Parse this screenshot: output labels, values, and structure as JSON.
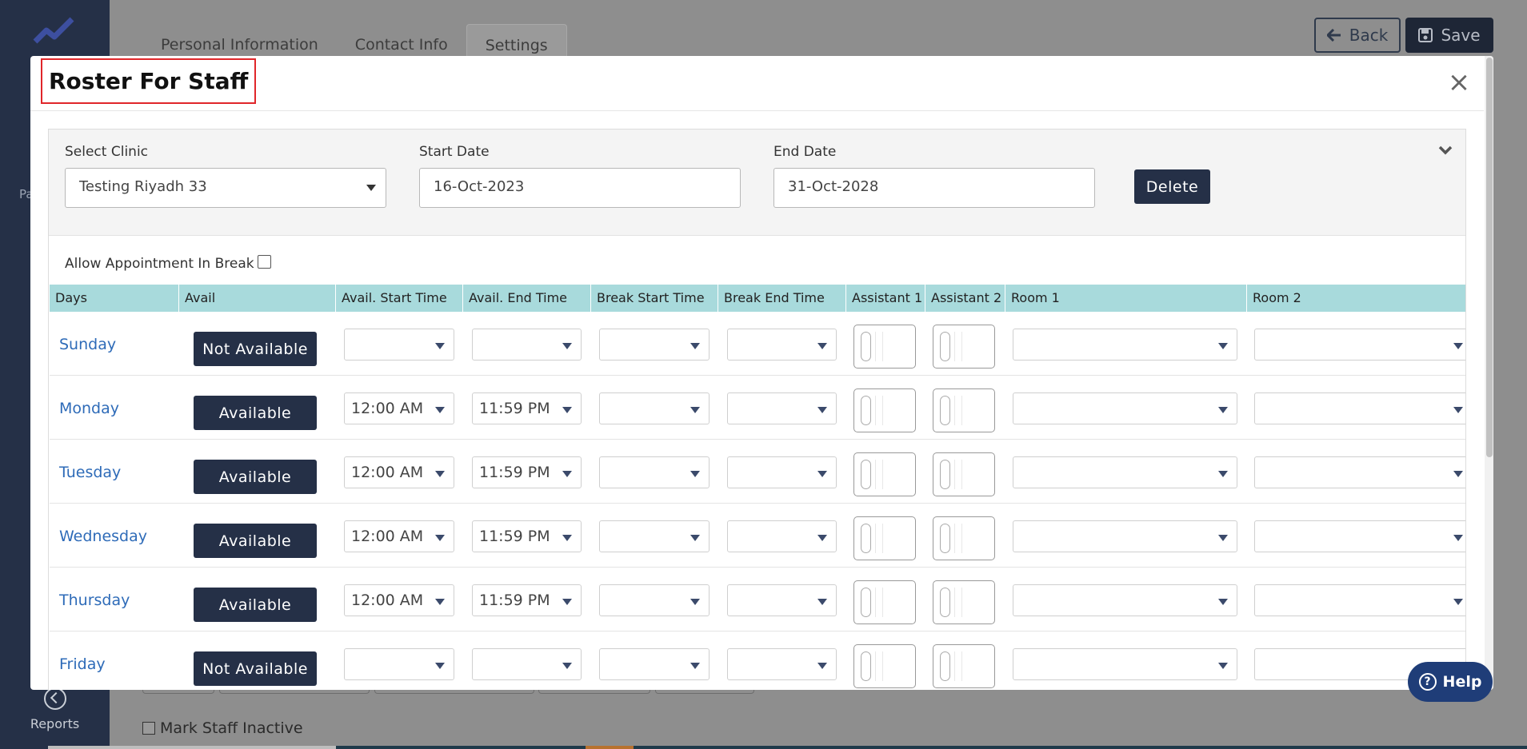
{
  "background": {
    "tabs": [
      {
        "label": "Personal Information"
      },
      {
        "label": "Contact Info"
      },
      {
        "label": "Settings"
      }
    ],
    "back_label": "Back",
    "save_label": "Save",
    "sidebar_partial_text": "Pa",
    "reports_label": "Reports",
    "mark_inactive_label": "Mark Staff Inactive"
  },
  "modal": {
    "title": "Roster For Staff",
    "close_glyph": "×",
    "filters": {
      "clinic_label": "Select Clinic",
      "clinic_value": "Testing Riyadh 33",
      "start_label": "Start Date",
      "start_value": "16-Oct-2023",
      "end_label": "End Date",
      "end_value": "31-Oct-2028",
      "delete_label": "Delete"
    },
    "allow_break_label": "Allow Appointment In Break",
    "table": {
      "headers": [
        "Days",
        "Avail",
        "Avail. Start Time",
        "Avail. End Time",
        "Break Start Time",
        "Break End Time",
        "Assistant 1",
        "Assistant 2",
        "Room 1",
        "Room 2"
      ],
      "rows": [
        {
          "day": "Sunday",
          "avail": "Not Available",
          "start": "",
          "end": ""
        },
        {
          "day": "Monday",
          "avail": "Available",
          "start": "12:00 AM",
          "end": "11:59 PM"
        },
        {
          "day": "Tuesday",
          "avail": "Available",
          "start": "12:00 AM",
          "end": "11:59 PM"
        },
        {
          "day": "Wednesday",
          "avail": "Available",
          "start": "12:00 AM",
          "end": "11:59 PM"
        },
        {
          "day": "Thursday",
          "avail": "Available",
          "start": "12:00 AM",
          "end": "11:59 PM"
        },
        {
          "day": "Friday",
          "avail": "Not Available",
          "start": "",
          "end": ""
        }
      ]
    }
  },
  "help_label": "Help",
  "colors": {
    "sidebar": "#253047",
    "button_dark": "#253047",
    "header_teal": "#a8dadc",
    "day_link": "#2e6bb8",
    "title_outline": "#e0262a",
    "help_bg": "#1f3d78"
  }
}
